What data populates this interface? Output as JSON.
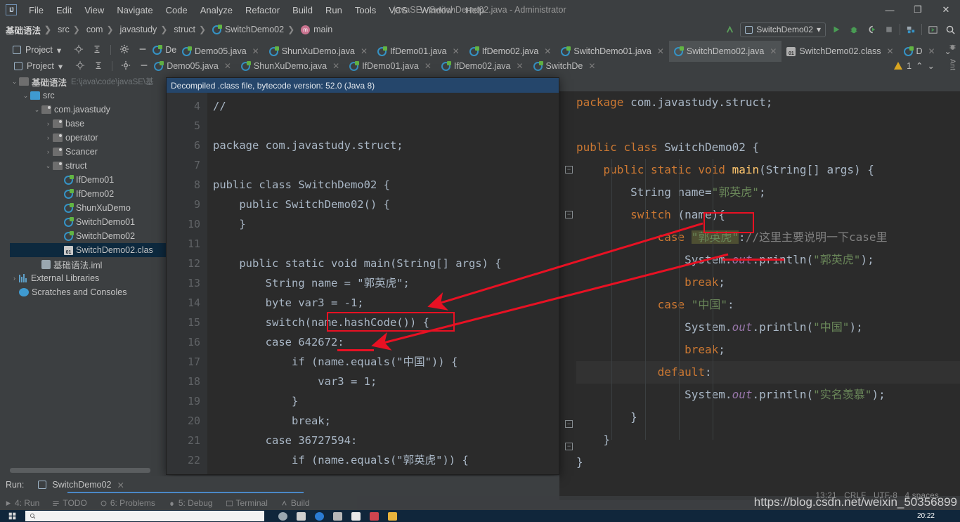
{
  "window": {
    "title": "javaSE - SwitchDemo02.java - Administrator",
    "minimize": "—",
    "maximize": "❐",
    "close": "✕",
    "logo": "IJ"
  },
  "menu": {
    "items": [
      "File",
      "Edit",
      "View",
      "Navigate",
      "Code",
      "Analyze",
      "Refactor",
      "Build",
      "Run",
      "Tools",
      "VCS",
      "Window",
      "Help"
    ]
  },
  "breadcrumb": {
    "items": [
      "基础语法",
      "src",
      "com",
      "javastudy",
      "struct",
      "SwitchDemo02",
      "main"
    ],
    "separator": "❯"
  },
  "toolbar": {
    "run_config": "SwitchDemo02",
    "dropdown_caret": "▾",
    "icons": [
      "update-icon",
      "run-icon",
      "debug-icon",
      "run-coverage-icon",
      "stop-icon",
      "project-structure-icon",
      "terminal-icon",
      "search-everywhere-icon"
    ]
  },
  "project_panel": {
    "title": "Project",
    "caret": "▾",
    "buttons": [
      "locate-icon",
      "collapse-all-icon",
      "settings-icon",
      "hide-icon"
    ],
    "tree": [
      {
        "label": "基础语法",
        "path": "E:\\java\\code\\javaSE\\基",
        "depth": 0,
        "icon": "module-folder-icon",
        "arrow": "v",
        "bold": true
      },
      {
        "label": "src",
        "path": "",
        "depth": 1,
        "icon": "source-folder-icon",
        "arrow": "v",
        "bold": false
      },
      {
        "label": "com.javastudy",
        "path": "",
        "depth": 2,
        "icon": "package-icon",
        "arrow": "v",
        "bold": false
      },
      {
        "label": "base",
        "path": "",
        "depth": 3,
        "icon": "package-icon",
        "arrow": ">",
        "bold": false
      },
      {
        "label": "operator",
        "path": "",
        "depth": 3,
        "icon": "package-icon",
        "arrow": ">",
        "bold": false
      },
      {
        "label": "Scancer",
        "path": "",
        "depth": 3,
        "icon": "package-icon",
        "arrow": ">",
        "bold": false
      },
      {
        "label": "struct",
        "path": "",
        "depth": 3,
        "icon": "package-icon",
        "arrow": "v",
        "bold": false
      },
      {
        "label": "IfDemo01",
        "path": "",
        "depth": 4,
        "icon": "java-class-icon",
        "arrow": "",
        "bold": false
      },
      {
        "label": "IfDemo02",
        "path": "",
        "depth": 4,
        "icon": "java-class-icon",
        "arrow": "",
        "bold": false
      },
      {
        "label": "ShunXuDemo",
        "path": "",
        "depth": 4,
        "icon": "java-class-icon",
        "arrow": "",
        "bold": false
      },
      {
        "label": "SwitchDemo01",
        "path": "",
        "depth": 4,
        "icon": "java-class-icon",
        "arrow": "",
        "bold": false
      },
      {
        "label": "SwitchDemo02",
        "path": "",
        "depth": 4,
        "icon": "java-class-icon",
        "arrow": "",
        "bold": false
      },
      {
        "label": "SwitchDemo02.clas",
        "path": "",
        "depth": 4,
        "icon": "class-file-icon",
        "arrow": "",
        "bold": false,
        "selected": true
      },
      {
        "label": "基础语法.iml",
        "path": "",
        "depth": 2,
        "icon": "iml-icon",
        "arrow": "",
        "bold": false
      },
      {
        "label": "External Libraries",
        "path": "",
        "depth": 0,
        "icon": "libraries-icon",
        "arrow": ">",
        "bold": false
      },
      {
        "label": "Scratches and Consoles",
        "path": "",
        "depth": 0,
        "icon": "scratches-icon",
        "arrow": "",
        "bold": false
      }
    ]
  },
  "editor_tabs": {
    "front": [
      {
        "label": "Demo05.java",
        "icon": "java-class-icon",
        "active": false
      },
      {
        "label": "ShunXuDemo.java",
        "icon": "java-class-icon",
        "active": false
      },
      {
        "label": "IfDemo01.java",
        "icon": "java-class-icon",
        "active": false
      },
      {
        "label": "IfDemo02.java",
        "icon": "java-class-icon",
        "active": false
      },
      {
        "label": "SwitchDemo01.java",
        "icon": "java-class-icon",
        "active": false
      },
      {
        "label": "SwitchDemo02.java",
        "icon": "java-class-icon",
        "active": true
      },
      {
        "label": "SwitchDemo02.class",
        "icon": "class-file-icon",
        "active": false
      },
      {
        "label": "D",
        "icon": "java-class-icon",
        "active": false
      }
    ],
    "ghost": [
      {
        "label": "Demo05.java",
        "icon": "java-class-icon"
      },
      {
        "label": "ShunXuDemo.java",
        "icon": "java-class-icon"
      },
      {
        "label": "IfDemo01.java",
        "icon": "java-class-icon"
      },
      {
        "label": "IfDemo02.java",
        "icon": "java-class-icon"
      },
      {
        "label": "SwitchDe",
        "icon": "java-class-icon"
      }
    ],
    "overflow_caret": "⌄",
    "close_glyph": "✕"
  },
  "inspection": {
    "warning_count": "1",
    "up_caret": "⌃",
    "down_caret": "⌄"
  },
  "right_rail": {
    "labels": [
      "Ant"
    ],
    "icon": "ant-bug-icon"
  },
  "decompiled_window": {
    "banner": "Decompiled .class file, bytecode version: 52.0 (Java 8)",
    "line_numbers": [
      "4",
      "5",
      "6",
      "7",
      "8",
      "9",
      "10",
      "11",
      "12",
      "13",
      "14",
      "15",
      "16",
      "17",
      "18",
      "19",
      "20",
      "21",
      "22"
    ],
    "lines": [
      "//",
      "",
      "package com.javastudy.struct;",
      "",
      "public class SwitchDemo02 {",
      "    public SwitchDemo02() {",
      "    }",
      "",
      "    public static void main(String[] args) {",
      "        String name = \"郭英虎\";",
      "        byte var3 = -1;",
      "        switch(name.hashCode()) {",
      "        case 642672:",
      "            if (name.equals(\"中国\")) {",
      "                var3 = 1;",
      "            }",
      "            break;",
      "        case 36727594:",
      "            if (name.equals(\"郭英虎\")) {"
    ]
  },
  "source_editor": {
    "lines": [
      "package com.javastudy.struct;",
      "",
      "public class SwitchDemo02 {",
      "    public static void main(String[] args) {",
      "        String name=\"郭英虎\";",
      "        switch (name){",
      "            case \"郭英虎\"://这里主要说明一下case里",
      "                System.out.println(\"郭英虎\");",
      "                break;",
      "            case \"中国\":",
      "                System.out.println(\"中国\");",
      "                break;",
      "            default:",
      "                System.out.println(\"实名羡慕\");",
      "        }",
      "    }",
      "}"
    ]
  },
  "run_panel": {
    "label": "Run:",
    "tab": "SwitchDemo02",
    "close": "✕",
    "icon": "run-tab-icon"
  },
  "bottom_tool_bar": {
    "items": [
      "4: Run",
      "TODO",
      "6: Problems",
      "5: Debug",
      "Terminal",
      "Build"
    ]
  },
  "status_bar": {
    "caret_position": "13:21",
    "line_separator": "CRLF",
    "encoding": "UTF-8",
    "indent": "4 spaces"
  },
  "watermark": "https://blog.csdn.net/weixin_50356899",
  "taskbar": {
    "search_placeholder": "",
    "clock_time": "20:22"
  },
  "colors": {
    "accent": "#4a88c7",
    "annotation_red": "#e81123",
    "banner_blue": "#25466b",
    "keyword_orange": "#cc7832",
    "string_green": "#6a8759",
    "editor_bg": "#2b2b2b",
    "chrome_bg": "#3c3f41"
  }
}
